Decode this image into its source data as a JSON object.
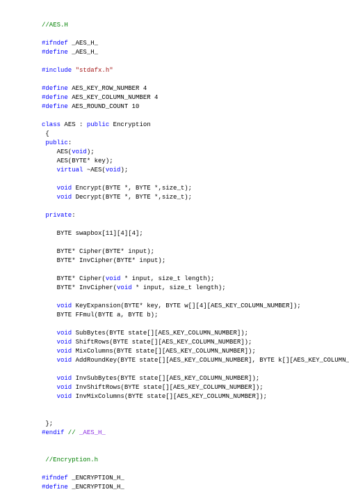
{
  "code": {
    "l01": "//AES.H",
    "l02_a": "#ifndef",
    "l02_b": " _AES_H_",
    "l03_a": "#define",
    "l03_b": " _AES_H_",
    "l04_a": "#include",
    "l04_b": " \"stdafx.h\"",
    "l05_a": "#define",
    "l05_b": " AES_KEY_ROW_NUMBER 4",
    "l06_a": "#define",
    "l06_b": " AES_KEY_COLUMN_NUMBER 4",
    "l07_a": "#define",
    "l07_b": " AES_ROUND_COUNT 10",
    "l08_a": "class",
    "l08_b": " AES : ",
    "l08_c": "public",
    "l08_d": " Encryption",
    "l09": " {",
    "l10_a": " ",
    "l10_b": "public",
    "l10_c": ":",
    "l11_a": "    AES(",
    "l11_b": "void",
    "l11_c": ");",
    "l12": "    AES(BYTE* key);",
    "l13_a": "    ",
    "l13_b": "virtual",
    "l13_c": " ~AES(",
    "l13_d": "void",
    "l13_e": ");",
    "l14_a": "    ",
    "l14_b": "void",
    "l14_c": " Encrypt(BYTE *, BYTE *,size_t);",
    "l15_a": "    ",
    "l15_b": "void",
    "l15_c": " Decrypt(BYTE *, BYTE *,size_t);",
    "l16_a": " ",
    "l16_b": "private",
    "l16_c": ":",
    "l17": "    BYTE swapbox[11][4][4];",
    "l18": "    BYTE* Cipher(BYTE* input);",
    "l19": "    BYTE* InvCipher(BYTE* input);",
    "l20_a": "    BYTE* Cipher(",
    "l20_b": "void",
    "l20_c": " * input, size_t length);",
    "l21_a": "    BYTE* InvCipher(",
    "l21_b": "void",
    "l21_c": " * input, size_t length);",
    "l22_a": "    ",
    "l22_b": "void",
    "l22_c": " KeyExpansion(BYTE* key, BYTE w[][4][AES_KEY_COLUMN_NUMBER]);",
    "l23": "    BYTE FFmul(BYTE a, BYTE b);",
    "l24_a": "    ",
    "l24_b": "void",
    "l24_c": " SubBytes(BYTE state[][AES_KEY_COLUMN_NUMBER]);",
    "l25_a": "    ",
    "l25_b": "void",
    "l25_c": " ShiftRows(BYTE state[][AES_KEY_COLUMN_NUMBER]);",
    "l26_a": "    ",
    "l26_b": "void",
    "l26_c": " MixColumns(BYTE state[][AES_KEY_COLUMN_NUMBER]);",
    "l27_a": "    ",
    "l27_b": "void",
    "l27_c": " AddRoundKey(BYTE state[][AES_KEY_COLUMN_NUMBER], BYTE k[][AES_KEY_COLUMN_NUMBER]);",
    "l28_a": "    ",
    "l28_b": "void",
    "l28_c": " InvSubBytes(BYTE state[][AES_KEY_COLUMN_NUMBER]);",
    "l29_a": "    ",
    "l29_b": "void",
    "l29_c": " InvShiftRows(BYTE state[][AES_KEY_COLUMN_NUMBER]);",
    "l30_a": "    ",
    "l30_b": "void",
    "l30_c": " InvMixColumns(BYTE state[][AES_KEY_COLUMN_NUMBER]);",
    "l31": " };",
    "l32_a": "#endif",
    "l32_b": " // ",
    "l32_c": "_AES_H_",
    "l33": " //Encryption.h",
    "l34_a": "#ifndef",
    "l34_b": " _ENCRYPTION_H_",
    "l35_a": "#define",
    "l35_b": " _ENCRYPTION_H_"
  }
}
